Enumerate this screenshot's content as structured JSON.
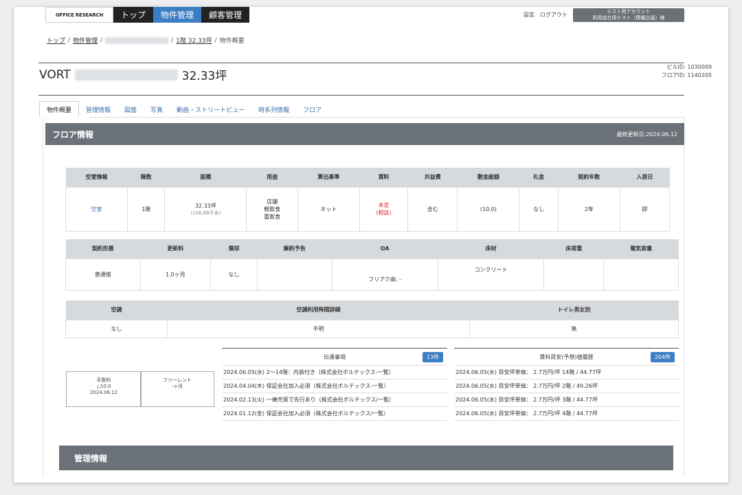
{
  "nav": {
    "logo": "OFFICE RESEARCH",
    "tabs": [
      "トップ",
      "物件管理",
      "顧客管理"
    ],
    "settings": "設定",
    "logout": "ログアウト",
    "account_line1": "テスト用アカウント",
    "account_line2": "利用会社用テスト（情報企画）様"
  },
  "breadcrumb": {
    "top": "トップ",
    "mgmt": "物件管理",
    "floor": "1階 32.33坪",
    "current": "物件概要"
  },
  "property": {
    "name_prefix": "VORT",
    "area": "32.33坪",
    "building_id": "ビルID: 1030009",
    "floor_id": "フロアID: 1140205"
  },
  "tabs": [
    "物件概要",
    "管理情報",
    "図面",
    "写真",
    "動画・ストリートビュー",
    "時系列情報",
    "フロア"
  ],
  "floor_info": {
    "title": "フロア情報",
    "updated": "最終更新日:2024.06.12"
  },
  "table1": {
    "headers": [
      "空室情報",
      "階数",
      "面積",
      "用途",
      "算出基準",
      "賃料",
      "共益費",
      "敷金総額",
      "礼金",
      "契約年数",
      "入居日"
    ],
    "vacancy": "空室",
    "floor": "1階",
    "area_tsubo": "32.33坪",
    "area_m2": "(106.88平米)",
    "use1": "店舗",
    "use2": "軽飲食",
    "use3": "重飲食",
    "basis": "ネット",
    "rent1": "未定",
    "rent2": "(相談)",
    "common_fee": "含む",
    "deposit": "(10.0)",
    "key_money": "なし",
    "term": "2年",
    "move_in": "即"
  },
  "table2": {
    "headers": [
      "契約形態",
      "更新料",
      "償却",
      "解約予告",
      "OA",
      "床材",
      "床荷重",
      "電気容量"
    ],
    "contract": "普通借",
    "renewal": "1.0ヶ月",
    "amortization": "なし",
    "notice": "",
    "oa": "フリアク高: -",
    "floor_material": "コンクリート",
    "load": "",
    "power": ""
  },
  "table3": {
    "headers": [
      "空調",
      "空調利用時間詳細",
      "トイレ男女別"
    ],
    "ac": "なし",
    "ac_detail": "不明",
    "toilet": "無"
  },
  "fee_box": {
    "l1": "手数料",
    "l2": "△10.0",
    "l3": "2024.06.12"
  },
  "free_rent": {
    "l1": "フリーレント",
    "l2": "-ヶ月"
  },
  "notes": {
    "title": "伝達事項",
    "count": "13件",
    "rows": [
      "2024.06.05(水) 2～14階：内装付き（株式会社ボルテックス-一覧）",
      "2024.04.04(木) 保証会社加入必須（株式会社ボルテックス-一覧）",
      "2024.02.13(火) 一棟売買で先行あり（株式会社ボルテックス/一覧）",
      "2024.01.12(金) 保証会社加入必須（株式会社ボルテックス/一覧）"
    ]
  },
  "history": {
    "title": "賃料目安(予想)値履歴",
    "count": "204件",
    "rows": [
      "2024.06.05(水) 目安坪単価： 2.7万円/坪 14階 / 44.77坪",
      "2024.06.05(水) 目安坪単価： 2.7万円/坪 2階 / 49.26坪",
      "2024.06.05(水) 目安坪単価： 2.7万円/坪 3階 / 44.77坪",
      "2024.06.05(水) 目安坪単価： 2.7万円/坪 4階 / 44.77坪"
    ]
  },
  "mgmt_section": {
    "title": "管理情報"
  }
}
